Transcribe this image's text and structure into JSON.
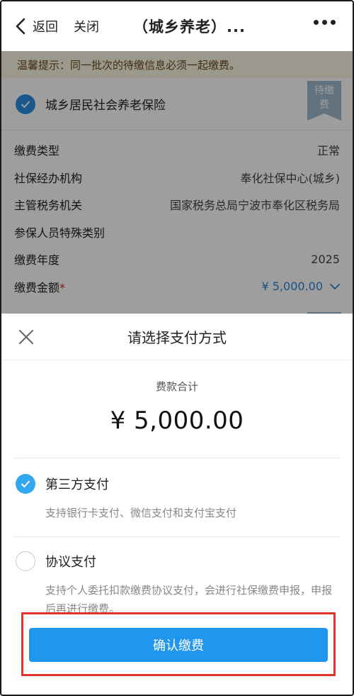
{
  "nav": {
    "back_label": "返回",
    "close_label": "关闭",
    "title": "（城乡养老）..."
  },
  "tip": "温馨提示：同一批次的待缴信息必须一起缴费。",
  "card": {
    "name": "城乡居民社会养老保险",
    "ribbon": [
      "待缴",
      "费"
    ],
    "rows": [
      {
        "label": "缴费类型",
        "value": "正常"
      },
      {
        "label": "社保经办机构",
        "value": "奉化社保中心(城乡)"
      },
      {
        "label": "主管税务机关",
        "value": "国家税务总局宁波市奉化区税务局"
      },
      {
        "label": "参保人员特殊类别",
        "value": ""
      },
      {
        "label": "缴费年度",
        "value": "2025"
      }
    ],
    "amount_label": "缴费金额",
    "amount_star": "*",
    "amount_value": "¥ 5,000.00"
  },
  "sheet": {
    "title": "请选择支付方式",
    "sum_label": "费款合计",
    "sum_value": "¥ 5,000.00",
    "options": [
      {
        "title": "第三方支付",
        "desc": "支持银行卡支付、微信支付和支付宝支付",
        "selected": true
      },
      {
        "title": "协议支付",
        "desc": "支持个人委托扣款缴费协议支付，会进行社保缴费申报，申报后再进行缴费。",
        "selected": false
      }
    ],
    "confirm_label": "确认缴费"
  },
  "colors": {
    "accent": "#2196ee",
    "check": "#31a8ef",
    "highlight_border": "#e3342f",
    "amount": "#2a82d4"
  }
}
